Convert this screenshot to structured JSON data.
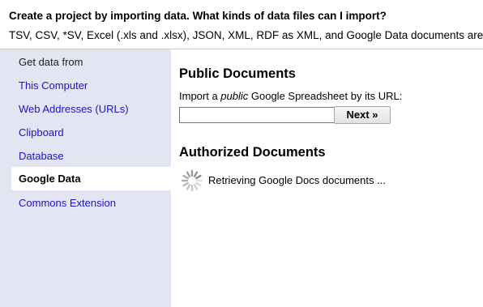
{
  "header": {
    "title_lead": "Create a project by importing data.",
    "title_link": "What kinds of data files can I import?",
    "subtitle": "TSV, CSV, *SV, Excel (.xls and .xlsx), JSON, XML, RDF as XML, and Google Data documents are all supported."
  },
  "sidebar": {
    "label": "Get data from",
    "items": [
      {
        "label": "This Computer"
      },
      {
        "label": "Web Addresses (URLs)"
      },
      {
        "label": "Clipboard"
      },
      {
        "label": "Database"
      },
      {
        "label": "Google Data",
        "active": true
      },
      {
        "label": "Commons Extension"
      }
    ]
  },
  "main": {
    "public_heading": "Public Documents",
    "instruction_pre": "Import a ",
    "instruction_em": "public",
    "instruction_post": " Google Spreadsheet by its URL:",
    "url_value": "",
    "next_label": "Next »",
    "authorized_heading": "Authorized Documents",
    "loading_text": "Retrieving Google Docs documents ..."
  },
  "colors": {
    "sidebar_bg": "#e3e5f3",
    "link": "#1c14c8"
  },
  "icons": {
    "spinner": "loading-spinner-icon"
  }
}
